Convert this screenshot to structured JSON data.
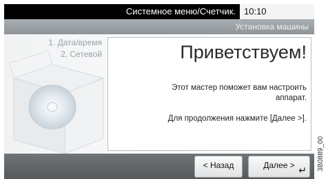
{
  "status_bar": {
    "title": "Системное меню/Счетчик.",
    "time": "10:10"
  },
  "header": {
    "title": "Установка машины"
  },
  "steps": [
    {
      "label": "1. Дата/время"
    },
    {
      "label": "2. Сетевой"
    }
  ],
  "panel": {
    "heading": "Приветствуем!",
    "description": "Этот мастер поможет вам настроить аппарат.",
    "instruction": "Для продолжения нажмите [Далее >]."
  },
  "buttons": {
    "back_label": "< Назад",
    "next_label": "Далее >",
    "enter_icon": "↵"
  },
  "side_code": "3B0889_00",
  "colors": {
    "status_bar": "#000000",
    "title_bar": "#9aa0a4",
    "bottom_bar": "#5f6367",
    "panel_border": "#b9bec2"
  }
}
